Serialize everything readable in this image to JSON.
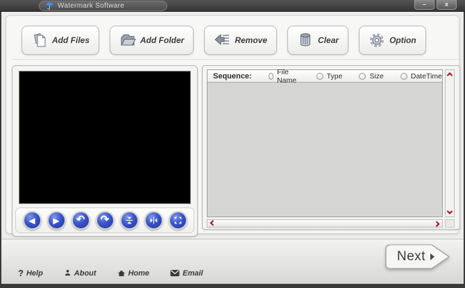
{
  "window": {
    "title": "Watermark Software",
    "minimize_label": "–",
    "close_label": "x"
  },
  "toolbar": {
    "buttons": [
      {
        "label": "Add Files",
        "icon": "add-files-icon"
      },
      {
        "label": "Add Folder",
        "icon": "add-folder-icon"
      },
      {
        "label": "Remove",
        "icon": "remove-icon"
      },
      {
        "label": "Clear",
        "icon": "clear-trash-icon"
      },
      {
        "label": "Option",
        "icon": "option-gear-icon"
      }
    ]
  },
  "preview": {
    "controls": [
      {
        "name": "previous",
        "glyph": "◀"
      },
      {
        "name": "next",
        "glyph": "▶"
      },
      {
        "name": "rotate-left",
        "glyph": "↶"
      },
      {
        "name": "rotate-right",
        "glyph": "↷"
      },
      {
        "name": "flip-vertical",
        "glyph": ""
      },
      {
        "name": "flip-horizontal",
        "glyph": ""
      },
      {
        "name": "fit-view",
        "glyph": ""
      }
    ]
  },
  "file_list": {
    "sequence_label": "Sequence:",
    "sort_options": [
      {
        "label": "File Name",
        "selected": false
      },
      {
        "label": "Type",
        "selected": false
      },
      {
        "label": "Size",
        "selected": false
      },
      {
        "label": "DateTime",
        "selected": false
      }
    ],
    "rows": []
  },
  "footer": {
    "next_label": "Next",
    "links": [
      {
        "label": "Help",
        "icon": "help-icon",
        "glyph": "?"
      },
      {
        "label": "About",
        "icon": "about-person-icon"
      },
      {
        "label": "Home",
        "icon": "home-icon"
      },
      {
        "label": "Email",
        "icon": "email-icon"
      }
    ]
  },
  "colors": {
    "titlebar": "#3e3e3e",
    "accent_blue": "#3550b8",
    "scroll_arrow_red": "#a01515",
    "list_bg": "#d5d5d3",
    "body_bg": "#ececea"
  }
}
